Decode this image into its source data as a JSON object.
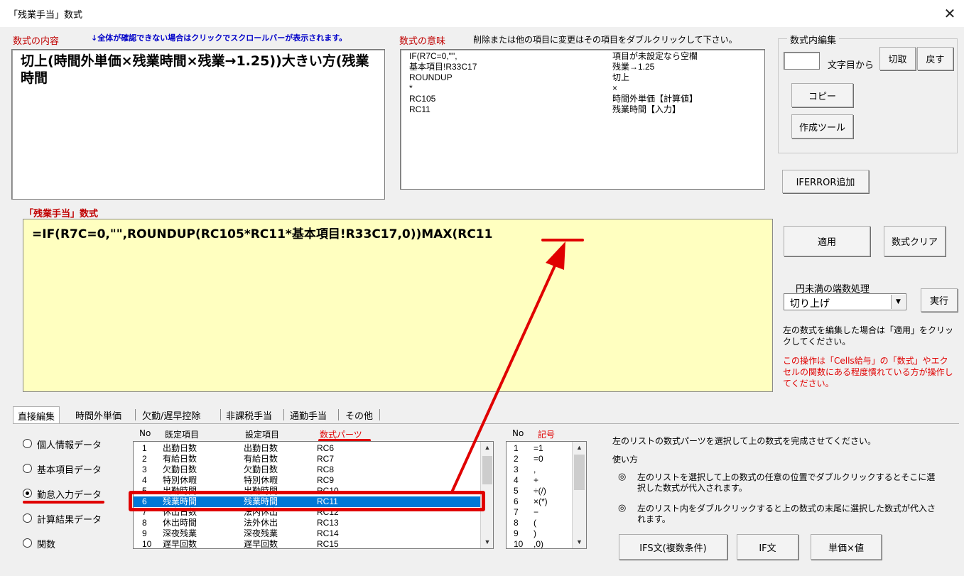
{
  "window": {
    "title": "「残業手当」数式",
    "close_icon": "close-icon"
  },
  "content_section": {
    "label": "数式の内容",
    "hint": "↓全体が確認できない場合はクリックでスクロールバーが表示されます。",
    "text": "切上(時間外単価×残業時間×残業→1.25))大きい方(残業時間"
  },
  "meaning_section": {
    "label": "数式の意味",
    "hint": "削除または他の項目に変更はその項目をダブルクリックして下さい。",
    "rows": [
      {
        "code": "IF(R7C=0,\"\",",
        "meaning": "項目が未設定なら空欄"
      },
      {
        "code": "基本項目!R33C17",
        "meaning": "残業→1.25"
      },
      {
        "code": "ROUNDUP",
        "meaning": "切上"
      },
      {
        "code": "*",
        "meaning": "×"
      },
      {
        "code": "RC105",
        "meaning": "時間外単価【計算値】"
      },
      {
        "code": "RC11",
        "meaning": "残業時間【入力】"
      }
    ]
  },
  "inline_edit": {
    "group_title": "数式内編集",
    "position_value": "",
    "position_suffix": "文字目から",
    "cut_label": "切取",
    "undo_label": "戻す",
    "copy_label": "コピー",
    "tool_label": "作成ツール"
  },
  "iferror_label": "IFERROR追加",
  "formula_section": {
    "label": "「残業手当」数式",
    "text_main": "=IF(R7C=0,\"\",ROUNDUP(RC105*RC11*基本項目!R33C17,0))MAX(",
    "text_tail": "RC11"
  },
  "apply_label": "適用",
  "clear_label": "数式クリア",
  "rounding": {
    "label": "円未満の端数処理",
    "selected": "切り上げ",
    "exec_label": "実行"
  },
  "note_black": "左の数式を編集した場合は「適用」をクリックしてください。",
  "note_red": "この操作は「Cells給与」の「数式」やエクセルの関数にある程度慣れている方が操作してください。",
  "tabs": [
    "直接編集",
    "時間外単価",
    "欠勤/遅早控除",
    "非課税手当",
    "通勤手当",
    "その他"
  ],
  "radios": [
    {
      "label": "個人情報データ",
      "checked": false
    },
    {
      "label": "基本項目データ",
      "checked": false
    },
    {
      "label": "勤怠入力データ",
      "checked": true
    },
    {
      "label": "計算結果データ",
      "checked": false
    },
    {
      "label": "関数",
      "checked": false
    }
  ],
  "parts_list": {
    "headers": {
      "no": "No",
      "default": "既定項目",
      "setting": "設定項目",
      "parts": "数式パーツ"
    },
    "rows": [
      {
        "no": "1",
        "default": "出勤日数",
        "setting": "出勤日数",
        "part": "RC6"
      },
      {
        "no": "2",
        "default": "有給日数",
        "setting": "有給日数",
        "part": "RC7"
      },
      {
        "no": "3",
        "default": "欠勤日数",
        "setting": "欠勤日数",
        "part": "RC8"
      },
      {
        "no": "4",
        "default": "特別休暇",
        "setting": "特別休暇",
        "part": "RC9"
      },
      {
        "no": "5",
        "default": "出勤時間",
        "setting": "出勤時間",
        "part": "RC10"
      },
      {
        "no": "6",
        "default": "残業時間",
        "setting": "残業時間",
        "part": "RC11"
      },
      {
        "no": "7",
        "default": "休出日数",
        "setting": "法内休出",
        "part": "RC12"
      },
      {
        "no": "8",
        "default": "休出時間",
        "setting": "法外休出",
        "part": "RC13"
      },
      {
        "no": "9",
        "default": "深夜残業",
        "setting": "深夜残業",
        "part": "RC14"
      },
      {
        "no": "10",
        "default": "遅早回数",
        "setting": "遅早回数",
        "part": "RC15"
      }
    ],
    "selected_index": 5
  },
  "symbol_list": {
    "headers": {
      "no": "No",
      "symbol": "記号"
    },
    "rows": [
      {
        "no": "1",
        "sym": "=1"
      },
      {
        "no": "2",
        "sym": "=0"
      },
      {
        "no": "3",
        "sym": ","
      },
      {
        "no": "4",
        "sym": "+"
      },
      {
        "no": "5",
        "sym": "÷(/)"
      },
      {
        "no": "6",
        "sym": "×(*)"
      },
      {
        "no": "7",
        "sym": "−"
      },
      {
        "no": "8",
        "sym": "("
      },
      {
        "no": "9",
        "sym": ")"
      },
      {
        "no": "10",
        "sym": ",0)"
      }
    ]
  },
  "help": {
    "intro": "左のリストの数式パーツを選択して上の数式を完成させてください。",
    "howto_title": "使い方",
    "item1": "左のリストを選択して上の数式の任意の位置でダブルクリックするとそこに選択した数式が代入されます。",
    "item2": "左のリスト内をダブルクリックすると上の数式の末尾に選択した数式が代入されます。",
    "bullet": "◎"
  },
  "bottom_buttons": {
    "ifs_label": "IFS文(複数条件)",
    "if_label": "IF文",
    "unit_label": "単価×値"
  },
  "colors": {
    "accent_red": "#e00000",
    "formula_bg": "#ffffc0",
    "selection": "#0078d7"
  }
}
